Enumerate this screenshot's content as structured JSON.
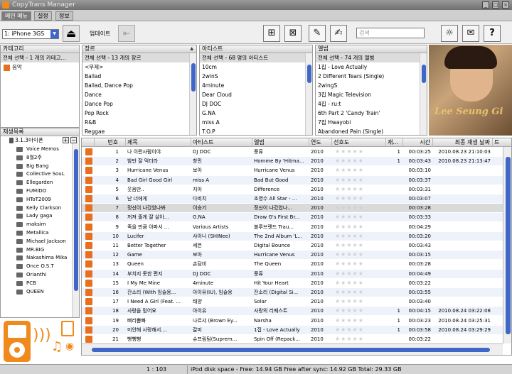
{
  "app": {
    "title": "CopyTrans Manager"
  },
  "menu": {
    "tabs": [
      "메인 메뉴",
      "설정",
      "정보"
    ]
  },
  "toolbar": {
    "device": "1: iPhone 3GS",
    "update_label": "업데이트",
    "search_placeholder": "검색"
  },
  "panels": {
    "category": {
      "header": "카테고리",
      "items": [
        "전체 선택 - 1 개의 카테고...",
        "음악"
      ]
    },
    "genre": {
      "header": "장르",
      "items": [
        "전체 선택 - 13 개의 장르",
        "<무제>",
        "Ballad",
        "Ballad, Dance Pop",
        "Dance",
        "Dance Pop",
        "Pop Rock",
        "R&B",
        "Reggae"
      ]
    },
    "artist": {
      "header": "아티스트",
      "items": [
        "전체 선택 - 68 명의 아티스트",
        "10cm",
        "2winS",
        "4minute",
        "Dear Cloud",
        "DJ DOC",
        "G.NA",
        "miss A",
        "T.O.P"
      ]
    },
    "album": {
      "header": "앨범",
      "items": [
        "전체 선택 - 74 개의 앨범",
        "1집 - Love Actually",
        "2 Different Tears (Single)",
        "2wingS",
        "3집 Magic Television",
        "4집 - ru:t",
        "6th Part 2 'Candy Train'",
        "7집 Hwayobi",
        "Abandoned Pain (Single)"
      ]
    }
  },
  "album_art": {
    "text": "Lee Seung Gi"
  },
  "playlists": {
    "header": "재생목록",
    "device": "3.1.3아이폰",
    "items": [
      "Voice Memos",
      "8월2주",
      "Big Bang",
      "Collective SouL",
      "Ellegarden",
      "FUMIDO",
      "HToT2009",
      "Kelly Clarkson",
      "Lady gaga",
      "maksim",
      "Metallica",
      "Michael Jackson",
      "MR.BIG",
      "Nakashima Mika",
      "Once O.S.T",
      "Orianthi",
      "PCB",
      "QUEEN"
    ]
  },
  "track_columns": [
    "번호",
    "제목",
    "아티스트",
    "앨범",
    "연도",
    "선호도",
    "재...",
    "시간",
    "최종 재생 날짜",
    "트"
  ],
  "tracks": [
    {
      "n": "1",
      "title": "나 이런사람이야",
      "artist": "DJ DOC",
      "album": "풍류",
      "year": "2010",
      "plays": "1",
      "time": "00:03:25",
      "last": "2010.08.23 21:10:03"
    },
    {
      "n": "2",
      "title": "밤만 잘 먹더라",
      "artist": "창민",
      "album": "Homme By 'Hitma...",
      "year": "2010",
      "plays": "1",
      "time": "00:03:43",
      "last": "2010.08.23 21:13:47"
    },
    {
      "n": "3",
      "title": "Hurricane Venus",
      "artist": "보아",
      "album": "Hurricane Venus",
      "year": "2010",
      "plays": "",
      "time": "00:03:10",
      "last": ""
    },
    {
      "n": "4",
      "title": "Bad Girl Good Girl",
      "artist": "miss A",
      "album": "Bad But Good",
      "year": "2010",
      "plays": "",
      "time": "00:03:37",
      "last": ""
    },
    {
      "n": "5",
      "title": "웃음만..",
      "artist": "지아",
      "album": "Difference",
      "year": "2010",
      "plays": "",
      "time": "00:03:31",
      "last": ""
    },
    {
      "n": "6",
      "title": "난 너에게",
      "artist": "다비치",
      "album": "조영수 All Star - ...",
      "year": "2010",
      "plays": "",
      "time": "00:03:07",
      "last": ""
    },
    {
      "n": "7",
      "title": "정신이 나갔었나봐",
      "artist": "이승기",
      "album": "정신이 나갔었나...",
      "year": "2010",
      "plays": "",
      "time": "00:03:28",
      "last": ""
    },
    {
      "n": "8",
      "title": "꺼져 줄게 잘 살아...",
      "artist": "G.NA",
      "album": "Draw G's First Br...",
      "year": "2010",
      "plays": "",
      "time": "00:03:33",
      "last": ""
    },
    {
      "n": "9",
      "title": "죽을 만큼 아파서 ...",
      "artist": "Various Artists",
      "album": "블루브랜드 Trau...",
      "year": "2010",
      "plays": "",
      "time": "00:04:29",
      "last": ""
    },
    {
      "n": "10",
      "title": "Lucifer",
      "artist": "샤이니 (SHINee)",
      "album": "The 2nd Album 'L...",
      "year": "2010",
      "plays": "",
      "time": "00:03:20",
      "last": ""
    },
    {
      "n": "11",
      "title": "Better Together",
      "artist": "세븐",
      "album": "Digital Bounce",
      "year": "2010",
      "plays": "",
      "time": "00:03:43",
      "last": ""
    },
    {
      "n": "12",
      "title": "Game",
      "artist": "보아",
      "album": "Hurricane Venus",
      "year": "2010",
      "plays": "",
      "time": "00:03:15",
      "last": ""
    },
    {
      "n": "13",
      "title": "Queen",
      "artist": "손담비",
      "album": "The Queen",
      "year": "2010",
      "plays": "",
      "time": "00:03:28",
      "last": ""
    },
    {
      "n": "14",
      "title": "부치지 못한 편지",
      "artist": "DJ DOC",
      "album": "풍류",
      "year": "2010",
      "plays": "",
      "time": "00:04:49",
      "last": ""
    },
    {
      "n": "15",
      "title": "I My Me Mine",
      "artist": "4minute",
      "album": "Hit Your Heart",
      "year": "2010",
      "plays": "",
      "time": "00:03:22",
      "last": ""
    },
    {
      "n": "16",
      "title": "잔소리 (With 임슬옹...",
      "artist": "아이유(IU), 임슬옹",
      "album": "잔소리 (Digital Si...",
      "year": "2010",
      "plays": "",
      "time": "00:03:55",
      "last": ""
    },
    {
      "n": "17",
      "title": "I Need A Girl (Feat. ...",
      "artist": "태양",
      "album": "Solar",
      "year": "2010",
      "plays": "",
      "time": "00:03:40",
      "last": ""
    },
    {
      "n": "18",
      "title": "사랑을 믿어요",
      "artist": "아이유",
      "album": "사랑의 리퀘스트",
      "year": "2010",
      "plays": "1",
      "time": "00:04:15",
      "last": "2010.08.24 03:22:08"
    },
    {
      "n": "19",
      "title": "삐리뽐빠",
      "artist": "나르샤 (Brown Ey...",
      "album": "Narsha",
      "year": "2010",
      "plays": "1",
      "time": "00:03:23",
      "last": "2010.08.24 03:25:31"
    },
    {
      "n": "20",
      "title": "미안해 사랑해서....",
      "artist": "갈미",
      "album": "1집 - Love Actually",
      "year": "2010",
      "plays": "1",
      "time": "00:03:58",
      "last": "2010.08.24 03:29:29"
    },
    {
      "n": "21",
      "title": "뻥뻥뻥",
      "artist": "슈프림팀(Suprem...",
      "album": "Spin Off (Repack...",
      "year": "2010",
      "plays": "",
      "time": "00:03:22",
      "last": ""
    }
  ],
  "status": {
    "count": "1 : 103",
    "disk": "iPod disk space - Free: 14.94 GB Free after sync: 14.92 GB Total: 29.33 GB"
  }
}
